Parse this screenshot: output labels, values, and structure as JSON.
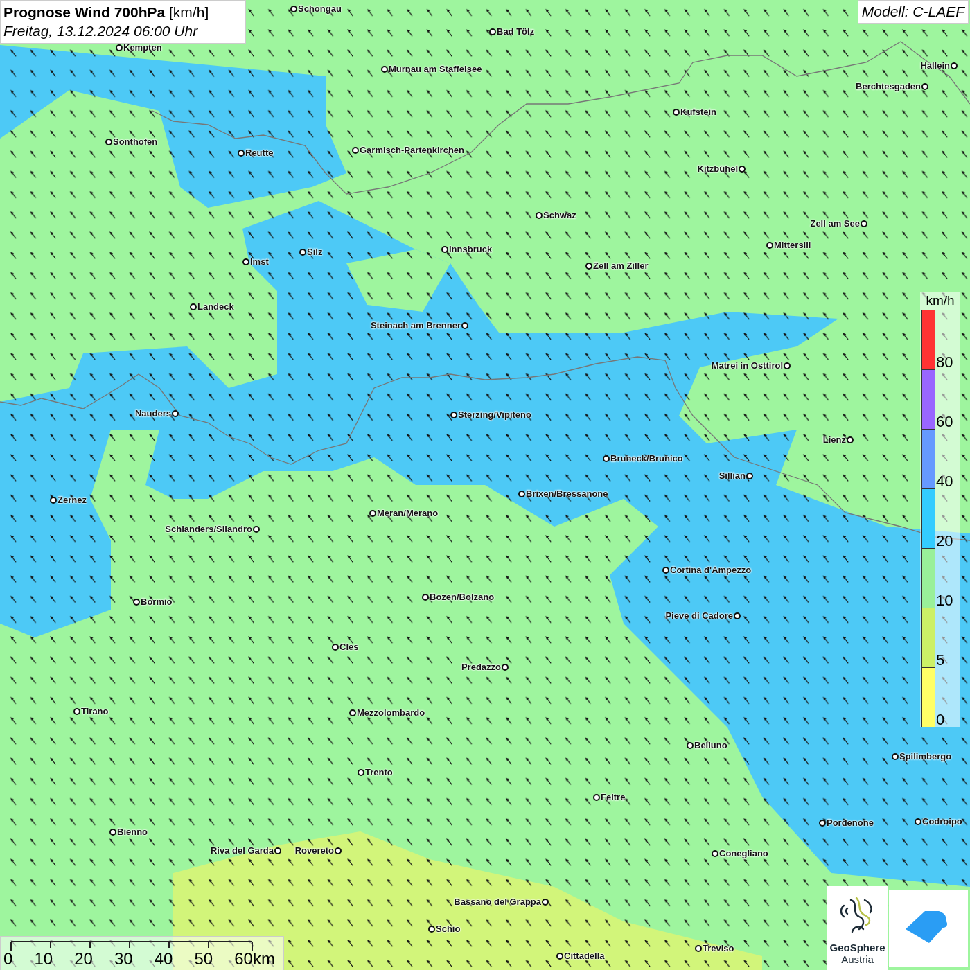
{
  "header": {
    "title": "**Prognose Wind 700hPa** [km/h]",
    "date": "Freitag, 13.12.2024 06:00 Uhr"
  },
  "model": "Modell: C-LAEF",
  "cities": [
    {
      "name": "Schongau"
    },
    {
      "name": "Bad Tölz"
    },
    {
      "name": "Kempten"
    },
    {
      "name": "Murnau am Staffelsee"
    },
    {
      "name": "Hallein"
    },
    {
      "name": "Berchtesgaden"
    },
    {
      "name": "Kufstein"
    },
    {
      "name": "Sonthofen"
    },
    {
      "name": "Reutte"
    },
    {
      "name": "Garmisch-Partenkirchen"
    },
    {
      "name": "Kitzbühel"
    },
    {
      "name": "Schwaz"
    },
    {
      "name": "Zell am See"
    },
    {
      "name": "Mittersill"
    },
    {
      "name": "Innsbruck"
    },
    {
      "name": "Silz"
    },
    {
      "name": "Imst"
    },
    {
      "name": "Zell am Ziller"
    },
    {
      "name": "Landeck"
    },
    {
      "name": "Steinach am Brenner"
    },
    {
      "name": "Matrei in Osttirol"
    },
    {
      "name": "Nauders"
    },
    {
      "name": "Sterzing/Vipiteno"
    },
    {
      "name": "Lienz"
    },
    {
      "name": "Bruneck/Brunico"
    },
    {
      "name": "Sillian"
    },
    {
      "name": "Brixen/Bressanone"
    },
    {
      "name": "Zernez"
    },
    {
      "name": "Meran/Merano"
    },
    {
      "name": "Schlanders/Silandro"
    },
    {
      "name": "Cortina d'Ampezzo"
    },
    {
      "name": "Bozen/Bolzano"
    },
    {
      "name": "Bormio"
    },
    {
      "name": "Pieve di Cadore"
    },
    {
      "name": "Cles"
    },
    {
      "name": "Predazzo"
    },
    {
      "name": "Tirano"
    },
    {
      "name": "Mezzolombardo"
    },
    {
      "name": "Belluno"
    },
    {
      "name": "Spilimbergo"
    },
    {
      "name": "Trento"
    },
    {
      "name": "Feltre"
    },
    {
      "name": "Codroipo"
    },
    {
      "name": "Pordenone"
    },
    {
      "name": "Bienno"
    },
    {
      "name": "Riva del Garda"
    },
    {
      "name": "Rovereto"
    },
    {
      "name": "Conegliano"
    },
    {
      "name": "Bassano del Grappa"
    },
    {
      "name": "Schio"
    },
    {
      "name": "Treviso"
    },
    {
      "name": "Cittadella"
    }
  ],
  "legend": {
    "unit": "km/h",
    "bins": [
      {
        "color": "#ff3333",
        "label": "80"
      },
      {
        "color": "#9966ff",
        "label": "60"
      },
      {
        "color": "#6699ff",
        "label": "40"
      },
      {
        "color": "#33ccff",
        "label": "20"
      },
      {
        "color": "#99f099",
        "label": "10"
      },
      {
        "color": "#ccf066",
        "label": "5"
      },
      {
        "color": "#ffff66",
        "label": "0"
      }
    ]
  },
  "scale": {
    "labels": [
      "0",
      "10",
      "20",
      "30",
      "40",
      "50",
      "60km"
    ]
  },
  "logo": {
    "name": "GeoSphere",
    "subtitle": "Austria"
  }
}
